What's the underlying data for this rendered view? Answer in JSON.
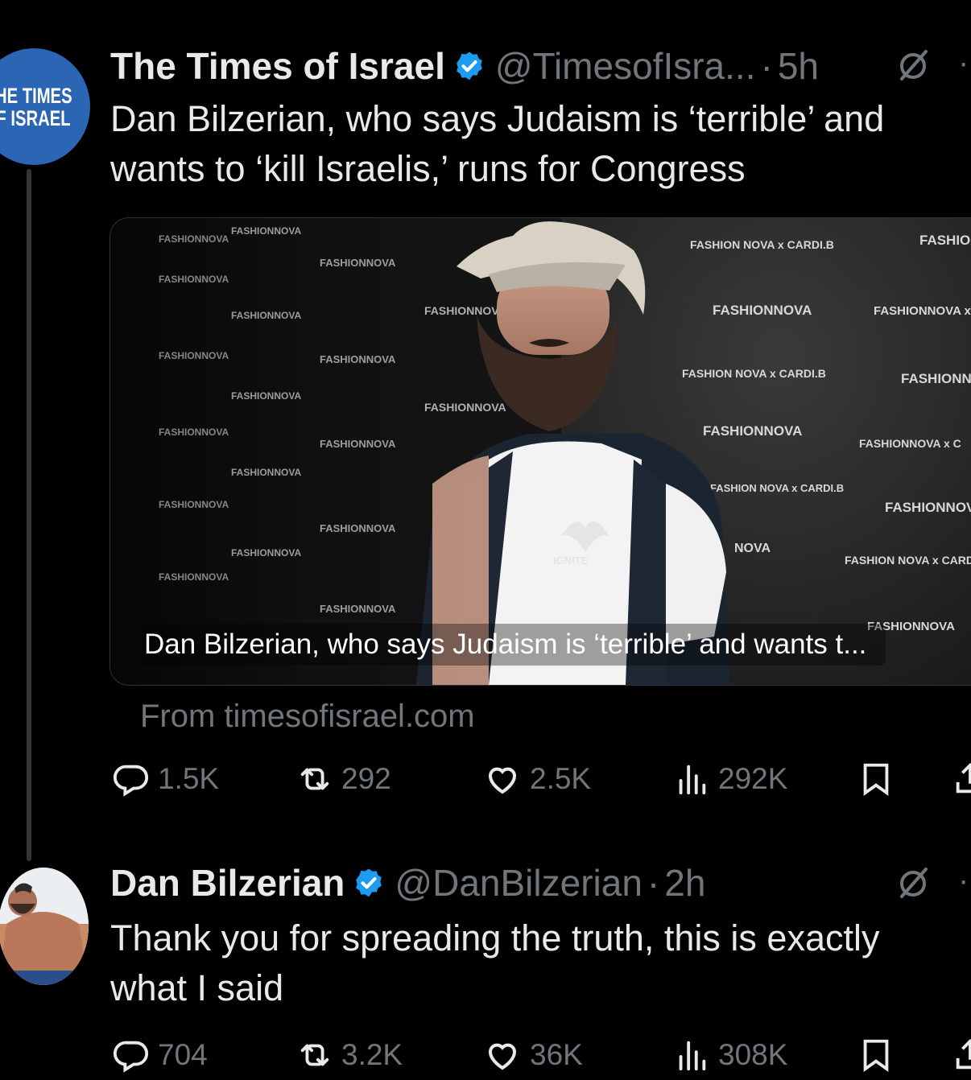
{
  "tweets": [
    {
      "avatar_text": [
        "HE TIMES",
        "F ISRAEL"
      ],
      "display_name": "The Times of Israel",
      "handle": "@TimesofIsra...",
      "dot": "·",
      "time": "5h",
      "text_lines": [
        "Dan Bilzerian, who says Judaism is ‘terrible’ and",
        "wants to ‘kill Israelis,’ runs for Congress"
      ],
      "card": {
        "caption": "Dan Bilzerian, who says Judaism is ‘terrible’ and wants t...",
        "source": "From timesofisrael.com",
        "backdrop_text": [
          "FASHIONNOVA",
          "FASHION NOVA x CARDI.B",
          "FASHIO",
          "FASHIONNOVA x C",
          "NOVA",
          "IGNITE"
        ]
      },
      "actions": {
        "replies": "1.5K",
        "reposts": "292",
        "likes": "2.5K",
        "views": "292K"
      }
    },
    {
      "display_name": "Dan Bilzerian",
      "handle": "@DanBilzerian",
      "dot": "·",
      "time": "2h",
      "text_lines": [
        "Thank you for spreading the truth, this is exactly",
        "what I said"
      ],
      "actions": {
        "replies": "704",
        "reposts": "3.2K",
        "likes": "36K",
        "views": "308K"
      }
    }
  ],
  "colors": {
    "background": "#000000",
    "text": "#e7e9ea",
    "muted": "#71767b",
    "verified": "#1d9bf0",
    "toi_brand": "#2a66b4"
  },
  "icons": [
    "verified-badge-icon",
    "grok-icon",
    "more-icon",
    "reply-icon",
    "repost-icon",
    "like-icon",
    "views-icon",
    "bookmark-icon",
    "share-icon"
  ]
}
